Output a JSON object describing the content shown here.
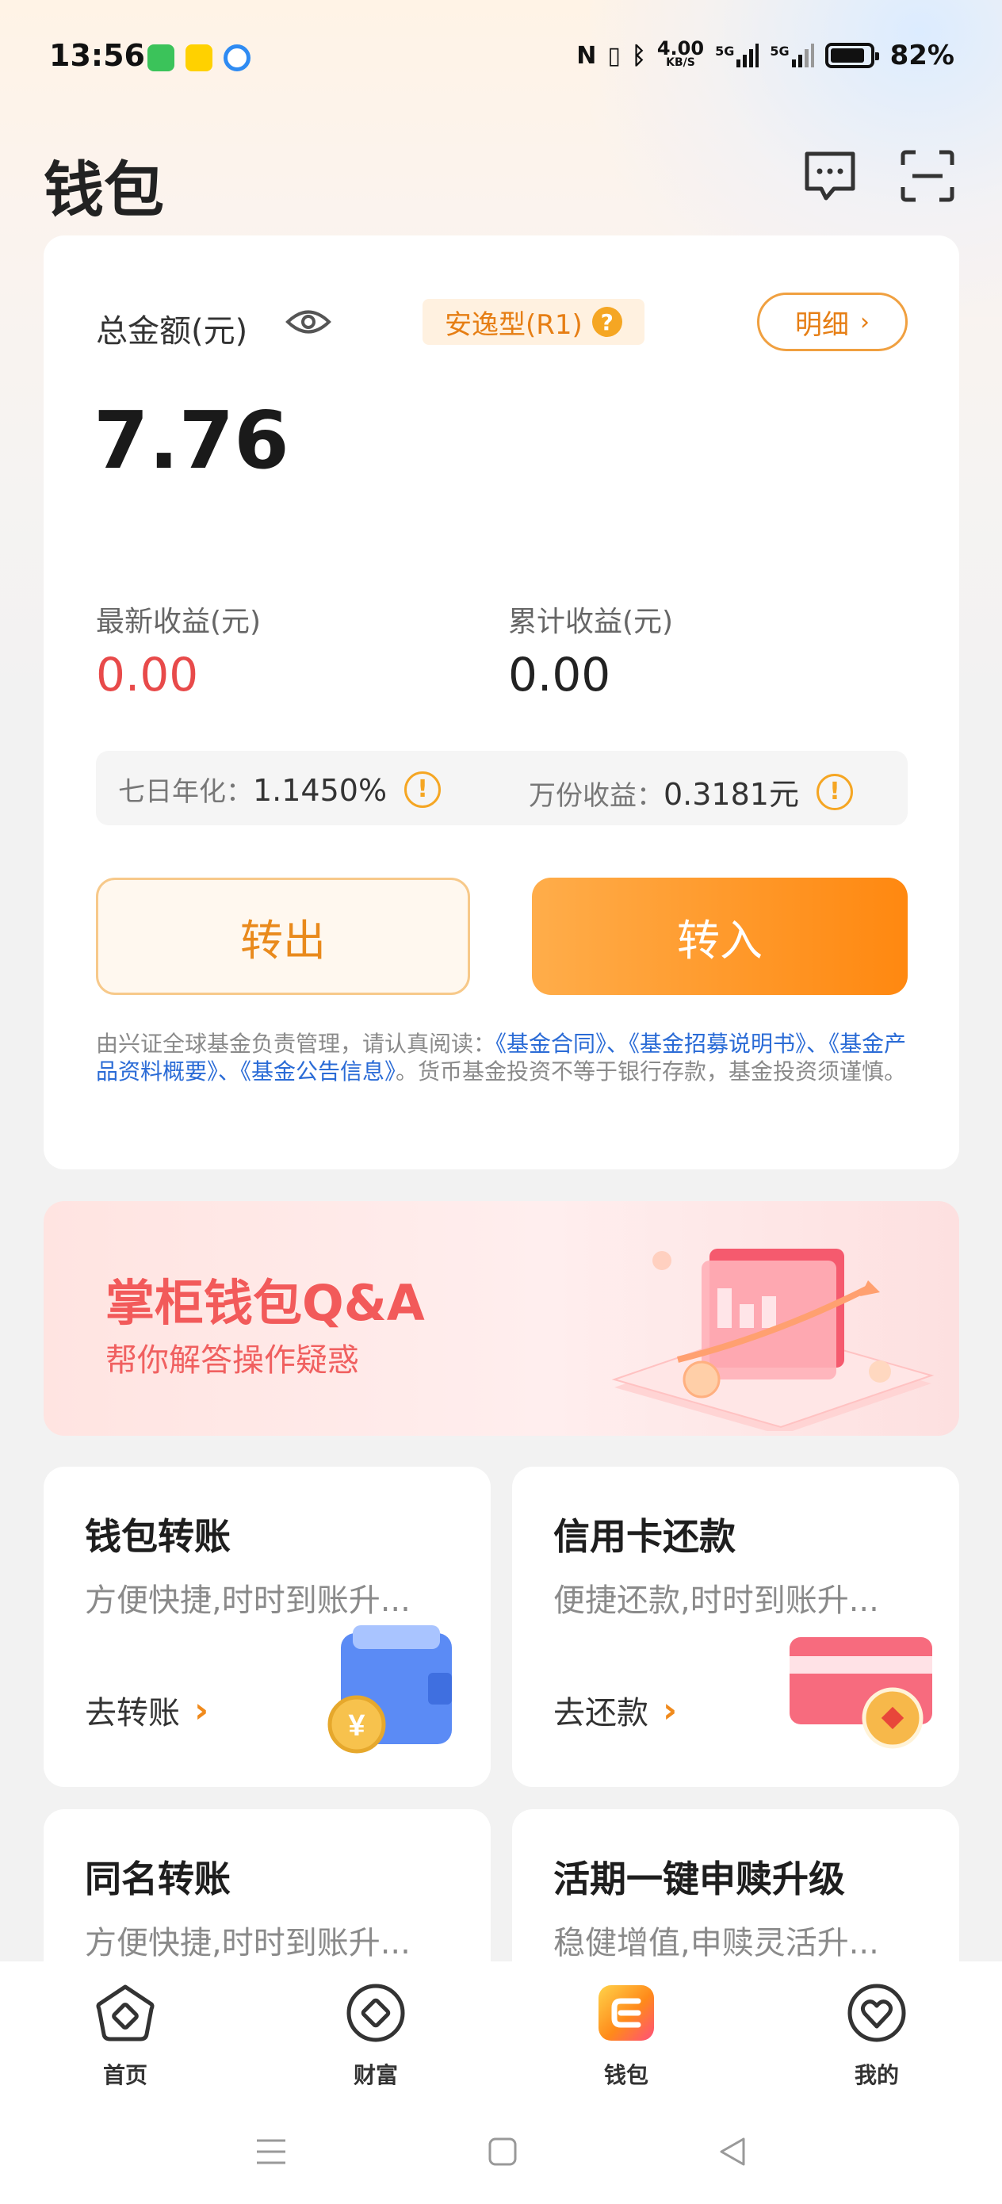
{
  "status_bar": {
    "time": "13:56",
    "net_speed_value": "4.00",
    "net_speed_unit": "KB/S",
    "signal1": "5G",
    "signal2": "5G",
    "battery": "82%"
  },
  "header": {
    "title": "钱包",
    "icons": [
      "message-icon",
      "scan-icon"
    ]
  },
  "wallet": {
    "total_label": "总金额(元)",
    "risk_badge": "安逸型(R1)",
    "detail_label": "明细",
    "amount": "7.76",
    "latest_income_label": "最新收益(元)",
    "latest_income_value": "0.00",
    "total_income_label": "累计收益(元)",
    "total_income_value": "0.00",
    "seven_day_label": "七日年化：",
    "seven_day_value": "1.1450%",
    "per_10k_label": "万份收益：",
    "per_10k_value": "0.3181元",
    "transfer_out": "转出",
    "transfer_in": "转入",
    "disclaimer_prefix": "由兴证全球基金负责管理，请认真阅读：",
    "link_contract": "《基金合同》",
    "sep1": "、",
    "link_prospectus": "《基金招募说明书》",
    "sep2": "、",
    "link_product": "《基金产品资料概要》",
    "sep3": "、",
    "link_notice": "《基金公告信息》",
    "disclaimer_suffix": "。货币基金投资不等于银行存款，基金投资须谨慎。"
  },
  "banner": {
    "title": "掌柜钱包Q&A",
    "subtitle": "帮你解答操作疑惑"
  },
  "features": [
    {
      "title": "钱包转账",
      "subtitle": "方便快捷,时时到账升...",
      "link": "去转账"
    },
    {
      "title": "信用卡还款",
      "subtitle": "便捷还款,时时到账升...",
      "link": "去还款"
    },
    {
      "title": "同名转账",
      "subtitle": "方便快捷,时时到账升..."
    },
    {
      "title": "活期一键申赎升级",
      "subtitle": "稳健增值,申赎灵活升..."
    }
  ],
  "bottom_nav": [
    {
      "label": "首页",
      "icon": "home-icon"
    },
    {
      "label": "财富",
      "icon": "wealth-icon"
    },
    {
      "label": "钱包",
      "icon": "wallet-icon"
    },
    {
      "label": "我的",
      "icon": "profile-icon"
    }
  ],
  "colors": {
    "accent_orange": "#ff8810",
    "income_red": "#e84a4a",
    "link_blue": "#2a6bd6",
    "banner_red": "#f25a5a"
  }
}
